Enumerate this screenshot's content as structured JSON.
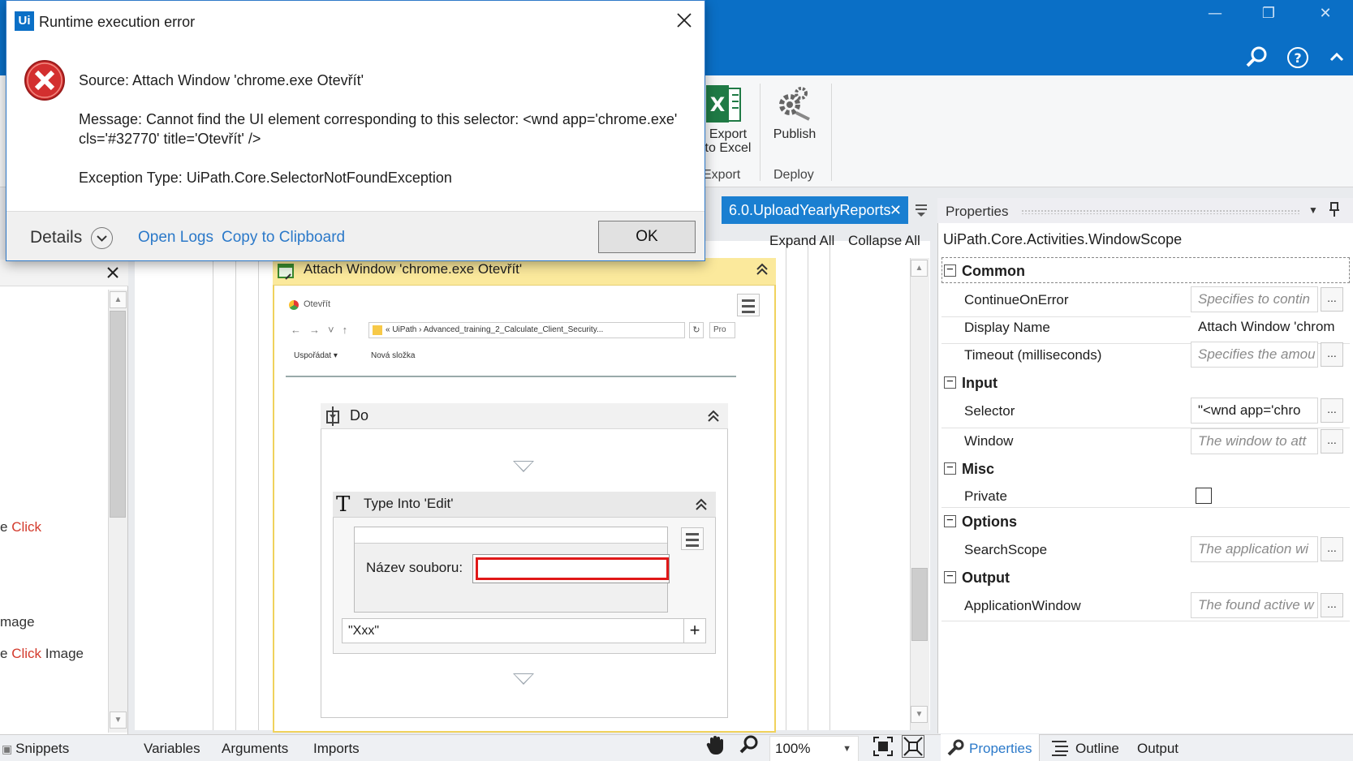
{
  "window": {
    "minimize_glyph": "—",
    "restore_glyph": "❐",
    "close_glyph": "✕",
    "search_glyph": "⚲",
    "help_glyph": "?",
    "collapse_ribbon_glyph": "^"
  },
  "ribbon": {
    "export_excel_label_1": "Export",
    "export_excel_label_2": "to Excel",
    "publish_label": "Publish",
    "group_export": "Export",
    "group_deploy": "Deploy"
  },
  "dialog": {
    "title": "Runtime execution error",
    "logo": "Ui",
    "source": "Source: Attach Window 'chrome.exe  Otevřít'",
    "message_line1": "Message: Cannot find the UI element corresponding to this selector: <wnd app='chrome.exe'",
    "message_line2": "cls='#32770' title='Otevřít' />",
    "exception": "Exception Type: UiPath.Core.SelectorNotFoundException",
    "details_label": "Details",
    "open_logs": "Open Logs",
    "copy_clipboard": "Copy to Clipboard",
    "ok_label": "OK"
  },
  "left_panel": {
    "item_click_prefix": "e ",
    "item_click_red": "Click",
    "item_image": "mage",
    "item_click_image_prefix": "e ",
    "item_click_image_red": "Click",
    "item_click_image_suffix": " Image",
    "snippets": "Snippets"
  },
  "designer": {
    "doc_tab": "6.0.UploadYearlyReports",
    "expand_all": "Expand All",
    "collapse_all": "Collapse All",
    "attach_title": "Attach Window 'chrome.exe  Otevřít'",
    "shot_title": "Otevřít",
    "shot_path": "« UiPath  ›  Advanced_training_2_Calculate_Client_Security...",
    "shot_search": "Pro",
    "shot_organize": "Uspořádat ▾",
    "shot_new_folder": "Nová složka",
    "do_label": "Do",
    "type_into_title": "Type Into 'Edit'",
    "field_label": "Název souboru:",
    "text_value": "\"Xxx\""
  },
  "properties": {
    "header": "Properties",
    "type_name": "UiPath.Core.Activities.WindowScope",
    "categories": {
      "common": "Common",
      "input": "Input",
      "misc": "Misc",
      "options": "Options",
      "output": "Output"
    },
    "rows": {
      "continue_on_error": {
        "name": "ContinueOnError",
        "value": "Specifies to contin"
      },
      "display_name": {
        "name": "Display Name",
        "value": "Attach Window 'chrom"
      },
      "timeout": {
        "name": "Timeout (milliseconds)",
        "value": "Specifies the amou"
      },
      "selector": {
        "name": "Selector",
        "value": "\"<wnd app='chro"
      },
      "window": {
        "name": "Window",
        "value": "The window to att"
      },
      "private": {
        "name": "Private"
      },
      "search_scope": {
        "name": "SearchScope",
        "value": "The application wi"
      },
      "application_window": {
        "name": "ApplicationWindow",
        "value": "The found active w"
      }
    }
  },
  "bottom": {
    "variables": "Variables",
    "arguments": "Arguments",
    "imports": "Imports",
    "zoom": "100%",
    "properties_tab": "Properties",
    "outline_tab": "Outline",
    "output_tab": "Output"
  },
  "colors": {
    "titlebar": "#0a6fc6",
    "doc_tab": "#1a7fd1",
    "attach_header": "#fbe99c",
    "error_red": "#d32f2f",
    "link_blue": "#2b79c9"
  }
}
